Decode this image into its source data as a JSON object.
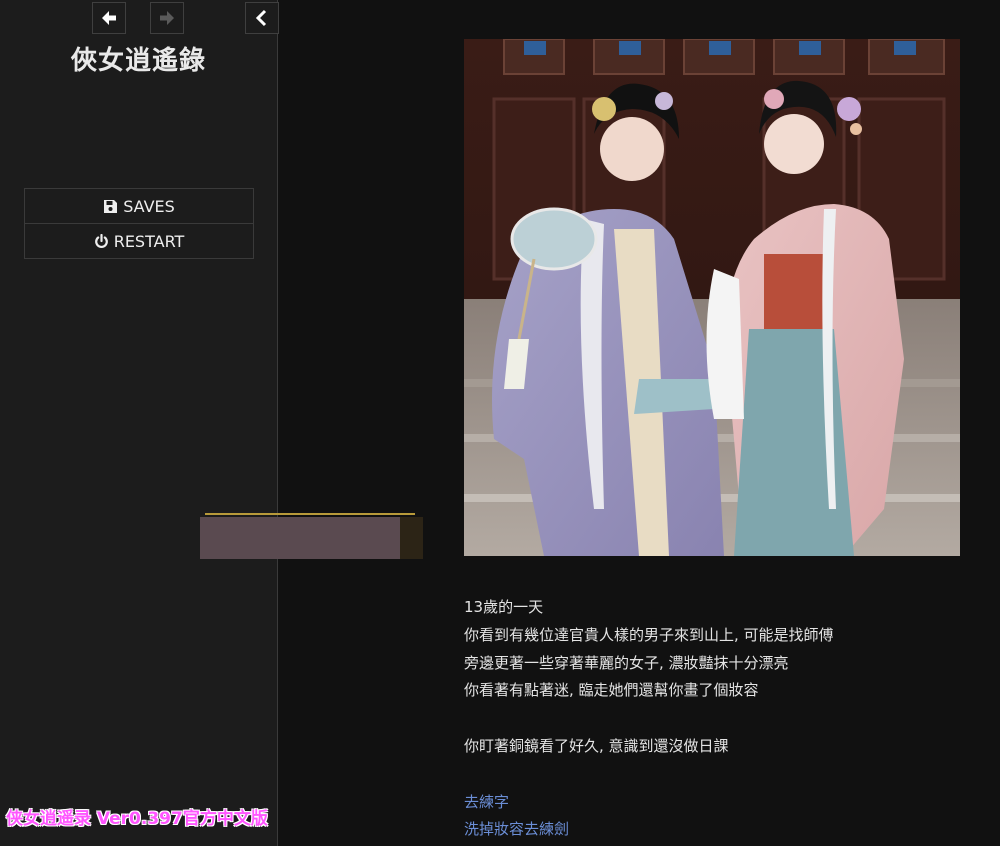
{
  "sidebar": {
    "title": "俠女逍遙錄",
    "saves_label": "SAVES",
    "restart_label": "RESTART"
  },
  "watermark": "侠女逍遥录 Ver0.397官方中文版",
  "passage": {
    "lines": [
      "13歲的一天",
      "你看到有幾位達官貴人樣的男子來到山上, 可能是找師傅",
      "旁邊更著一些穿著華麗的女子, 濃妝豔抹十分漂亮",
      "你看著有點著迷, 臨走她們還幫你畫了個妝容",
      "你盯著銅鏡看了好久, 意識到還沒做日課"
    ],
    "links": [
      "去練字",
      "洗掉妝容去練劍"
    ]
  },
  "colors": {
    "sidebar_bg": "#1c1c1c",
    "main_bg": "#111111",
    "text": "#e4e4e4",
    "link": "#6b8ed6",
    "watermark": "#ff55ff"
  },
  "icons": [
    "arrow-left-icon",
    "arrow-right-icon",
    "chevron-left-icon",
    "floppy-disk-icon",
    "power-icon"
  ]
}
